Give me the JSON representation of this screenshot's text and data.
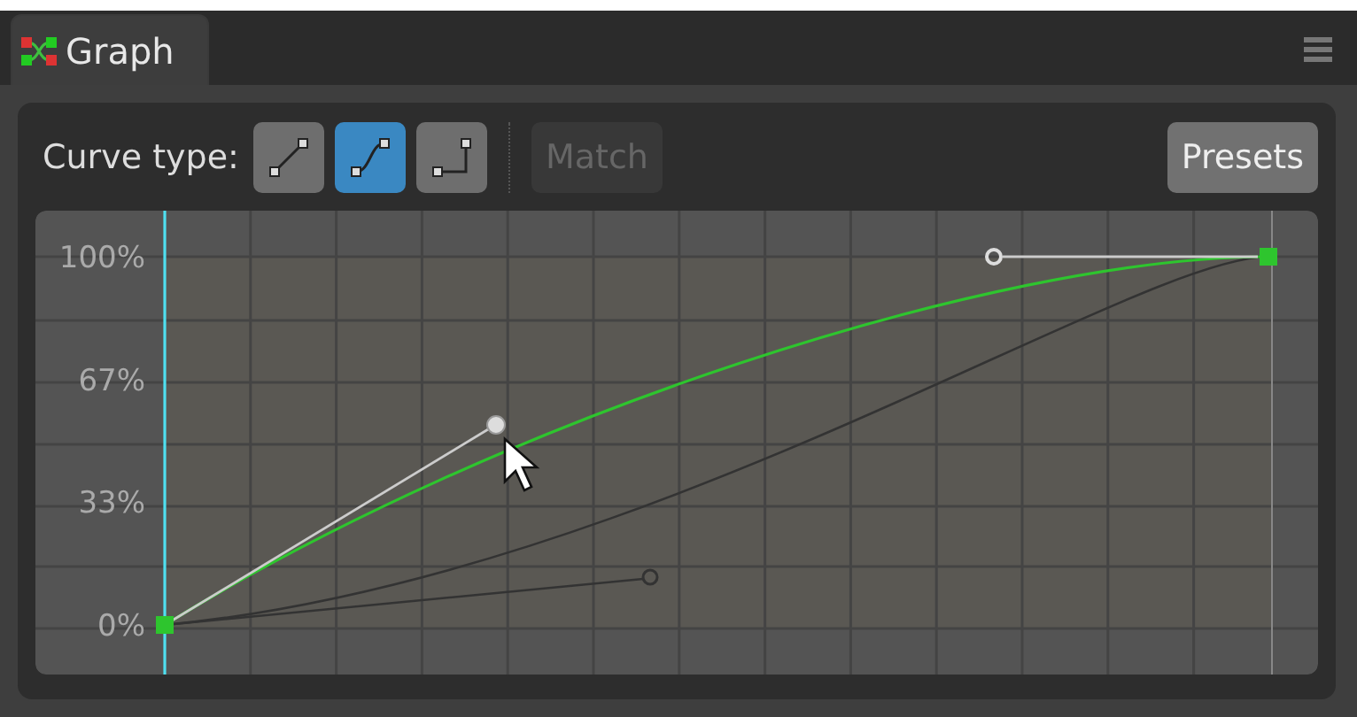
{
  "tab": {
    "label": "Graph",
    "selected": true
  },
  "toolbar": {
    "label": "Curve type:",
    "curve_types": [
      {
        "kind": "linear",
        "selected": false
      },
      {
        "kind": "smooth",
        "selected": true
      },
      {
        "kind": "step",
        "selected": false
      }
    ],
    "match": {
      "label": "Match",
      "disabled": true
    },
    "presets": {
      "label": "Presets"
    }
  },
  "graph": {
    "y_labels": [
      "100%",
      "67%",
      "33%",
      "0%"
    ]
  }
}
